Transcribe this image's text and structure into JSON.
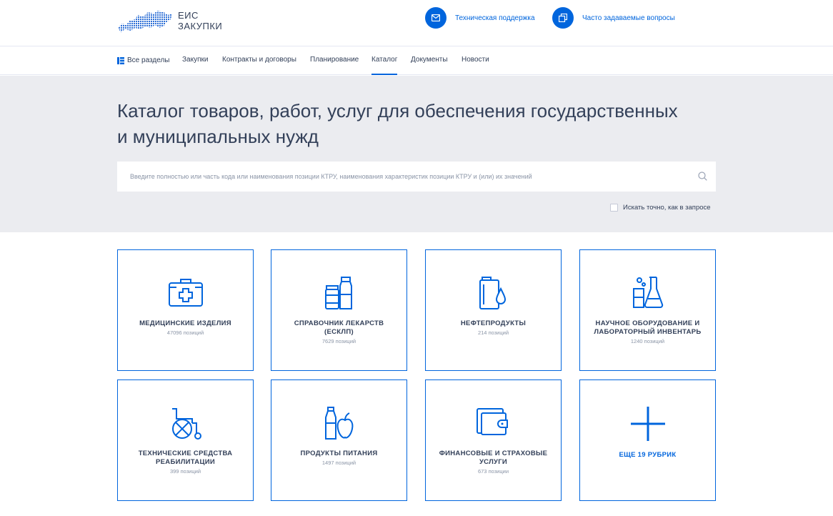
{
  "header": {
    "logo_line1": "ЕИС",
    "logo_line2": "ЗАКУПКИ",
    "support_label": "Техническая поддержка",
    "faq_label": "Часто задаваемые вопросы"
  },
  "nav": {
    "items": [
      {
        "label": "Все разделы"
      },
      {
        "label": "Закупки"
      },
      {
        "label": "Контракты и договоры"
      },
      {
        "label": "Планирование"
      },
      {
        "label": "Каталог",
        "active": true
      },
      {
        "label": "Документы"
      },
      {
        "label": "Новости"
      }
    ]
  },
  "hero": {
    "title_line1": "Каталог товаров, работ, услуг для обеспечения государственных",
    "title_line2": "и муниципальных нужд",
    "search_placeholder": "Введите полностью или часть кода или наименования позиции КТРУ, наименования характеристик позиции КТРУ и (или) их значений",
    "exact_label": "Искать точно, как в запросе"
  },
  "cards": [
    {
      "title": "МЕДИЦИНСКИЕ ИЗДЕЛИЯ",
      "count": "47096 позиций",
      "icon": "medkit-icon"
    },
    {
      "title": "СПРАВОЧНИК ЛЕКАРСТВ (ЕСКЛП)",
      "count": "7629 позиций",
      "icon": "medicine-bottles-icon"
    },
    {
      "title": "НЕФТЕПРОДУКТЫ",
      "count": "214 позиций",
      "icon": "oil-canister-icon"
    },
    {
      "title": "НАУЧНОЕ ОБОРУДОВАНИЕ И ЛАБОРАТОРНЫЙ ИНВЕНТАРЬ",
      "count": "1240 позиций",
      "icon": "lab-flask-icon"
    },
    {
      "title": "ТЕХНИЧЕСКИЕ СРЕДСТВА РЕАБИЛИТАЦИИ",
      "count": "399 позиций",
      "icon": "wheelchair-icon"
    },
    {
      "title": "ПРОДУКТЫ ПИТАНИЯ",
      "count": "1497 позиций",
      "icon": "food-bottle-apple-icon"
    },
    {
      "title": "ФИНАНСОВЫЕ И СТРАХОВЫЕ УСЛУГИ",
      "count": "673 позиции",
      "icon": "wallet-icon"
    }
  ],
  "more": {
    "label": "ЕЩЕ 19 РУБРИК",
    "icon": "plus-icon"
  },
  "colors": {
    "accent": "#0065dd",
    "text": "#334059",
    "muted": "#8a94a6",
    "hero_bg": "#ebecf0"
  }
}
